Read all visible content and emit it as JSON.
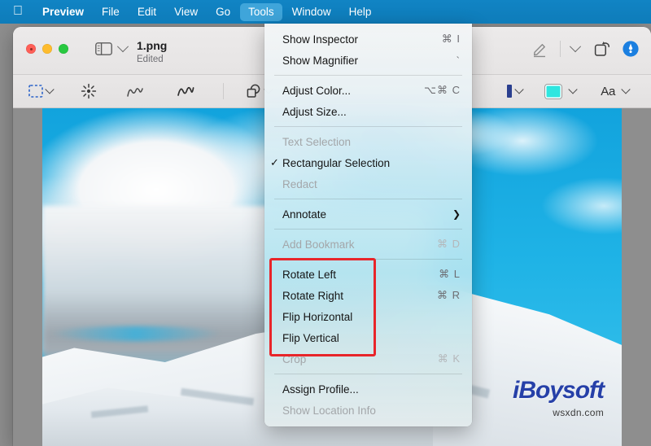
{
  "menubar": {
    "apple_icon": "apple-logo",
    "items": [
      {
        "label": "Preview",
        "bold": true,
        "active": false
      },
      {
        "label": "File",
        "bold": false,
        "active": false
      },
      {
        "label": "Edit",
        "bold": false,
        "active": false
      },
      {
        "label": "View",
        "bold": false,
        "active": false
      },
      {
        "label": "Go",
        "bold": false,
        "active": false
      },
      {
        "label": "Tools",
        "bold": false,
        "active": true
      },
      {
        "label": "Window",
        "bold": false,
        "active": false
      },
      {
        "label": "Help",
        "bold": false,
        "active": false
      }
    ]
  },
  "window": {
    "title": "1.png",
    "subtitle": "Edited",
    "traffic_lights": [
      "close-button",
      "minimize-button",
      "maximize-button"
    ],
    "sidebar_toggle_icon": "sidebar-icon",
    "title_right_icons": [
      "markup-pen-icon",
      "chevron-down-icon",
      "rotate-icon",
      "annotate-badge-icon"
    ]
  },
  "toolbar": {
    "items": [
      {
        "icon": "rectangular-selection-icon",
        "has_chevron": true
      },
      {
        "icon": "instant-alpha-icon",
        "has_chevron": false
      },
      {
        "icon": "sketch-icon",
        "has_chevron": false
      },
      {
        "icon": "draw-icon",
        "has_chevron": false
      },
      {
        "icon": "shapes-icon",
        "has_chevron": true
      },
      {
        "icon": "text-box-icon",
        "has_chevron": false
      },
      {
        "icon": "border-color-icon",
        "has_chevron": true
      },
      {
        "icon": "fill-color-icon",
        "has_chevron": true
      },
      {
        "icon": "text-style-icon",
        "has_chevron": true
      }
    ],
    "fill_color": "#2ee6e0",
    "text_style_label": "Aa"
  },
  "menu": {
    "groups": [
      {
        "items": [
          {
            "label": "Show Inspector",
            "shortcut": "⌘ I",
            "disabled": false,
            "checked": false,
            "submenu": false
          },
          {
            "label": "Show Magnifier",
            "shortcut": "`",
            "disabled": false,
            "checked": false,
            "submenu": false
          }
        ]
      },
      {
        "items": [
          {
            "label": "Adjust Color...",
            "shortcut": "⌥⌘ C",
            "disabled": false,
            "checked": false,
            "submenu": false
          },
          {
            "label": "Adjust Size...",
            "shortcut": "",
            "disabled": false,
            "checked": false,
            "submenu": false
          }
        ]
      },
      {
        "items": [
          {
            "label": "Text Selection",
            "shortcut": "",
            "disabled": true,
            "checked": false,
            "submenu": false
          },
          {
            "label": "Rectangular Selection",
            "shortcut": "",
            "disabled": false,
            "checked": true,
            "submenu": false
          },
          {
            "label": "Redact",
            "shortcut": "",
            "disabled": true,
            "checked": false,
            "submenu": false
          }
        ]
      },
      {
        "items": [
          {
            "label": "Annotate",
            "shortcut": "",
            "disabled": false,
            "checked": false,
            "submenu": true
          }
        ]
      },
      {
        "items": [
          {
            "label": "Add Bookmark",
            "shortcut": "⌘ D",
            "disabled": true,
            "checked": false,
            "submenu": false
          }
        ]
      },
      {
        "items": [
          {
            "label": "Rotate Left",
            "shortcut": "⌘ L",
            "disabled": false,
            "checked": false,
            "submenu": false
          },
          {
            "label": "Rotate Right",
            "shortcut": "⌘ R",
            "disabled": false,
            "checked": false,
            "submenu": false
          },
          {
            "label": "Flip Horizontal",
            "shortcut": "",
            "disabled": false,
            "checked": false,
            "submenu": false
          },
          {
            "label": "Flip Vertical",
            "shortcut": "",
            "disabled": false,
            "checked": false,
            "submenu": false
          },
          {
            "label": "Crop",
            "shortcut": "⌘ K",
            "disabled": true,
            "checked": false,
            "submenu": false
          }
        ]
      },
      {
        "items": [
          {
            "label": "Assign Profile...",
            "shortcut": "",
            "disabled": false,
            "checked": false,
            "submenu": false
          },
          {
            "label": "Show Location Info",
            "shortcut": "",
            "disabled": true,
            "checked": false,
            "submenu": false
          }
        ]
      }
    ]
  },
  "highlight": {
    "color": "#e8252a",
    "annotates": [
      "Rotate Left",
      "Rotate Right",
      "Flip Horizontal",
      "Flip Vertical"
    ]
  },
  "watermark": {
    "brand": "iBoysoft",
    "site": "wsxdn.com"
  },
  "colors": {
    "menubar_blue": "#0e7cba",
    "menubar_active": "#3fa5da",
    "sky_blue": "#1aa7dd",
    "desktop_gray": "#8e8e8e",
    "highlight_red": "#e8252a"
  }
}
